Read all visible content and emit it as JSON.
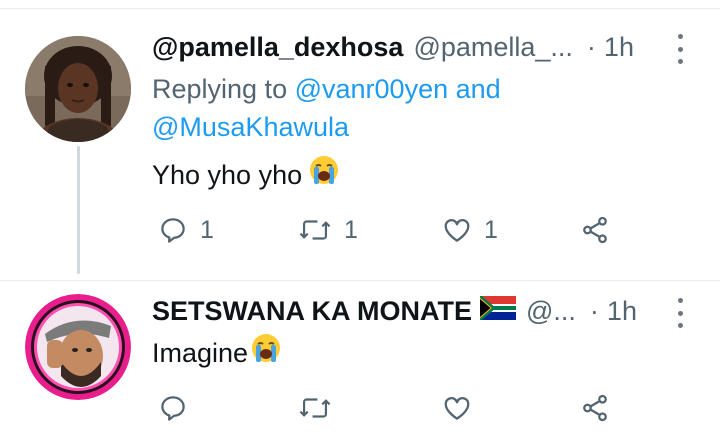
{
  "tweets": [
    {
      "display_name": "@pamella_dexhosa",
      "handle": "@pamella_...",
      "separator": "·",
      "time": "1h",
      "replying_prefix": "Replying to",
      "replying_mention_1": "@vanr00yen",
      "replying_and": "and",
      "replying_mention_2": "@MusaKhawula",
      "text": "Yho yho yho",
      "emoji": "loudly-crying-face",
      "actions": {
        "reply_count": "1",
        "retweet_count": "1",
        "like_count": "1"
      }
    },
    {
      "display_name": "SETSWANA KA MONATE",
      "flag": "south-africa-flag",
      "handle": "@...",
      "separator": "·",
      "time": "1h",
      "text": "Imagine",
      "emoji": "loudly-crying-face",
      "actions": {
        "reply_count": "",
        "retweet_count": "",
        "like_count": ""
      }
    }
  ],
  "colors": {
    "link": "#1d9bf0",
    "muted": "#536471",
    "text": "#0f1419"
  }
}
